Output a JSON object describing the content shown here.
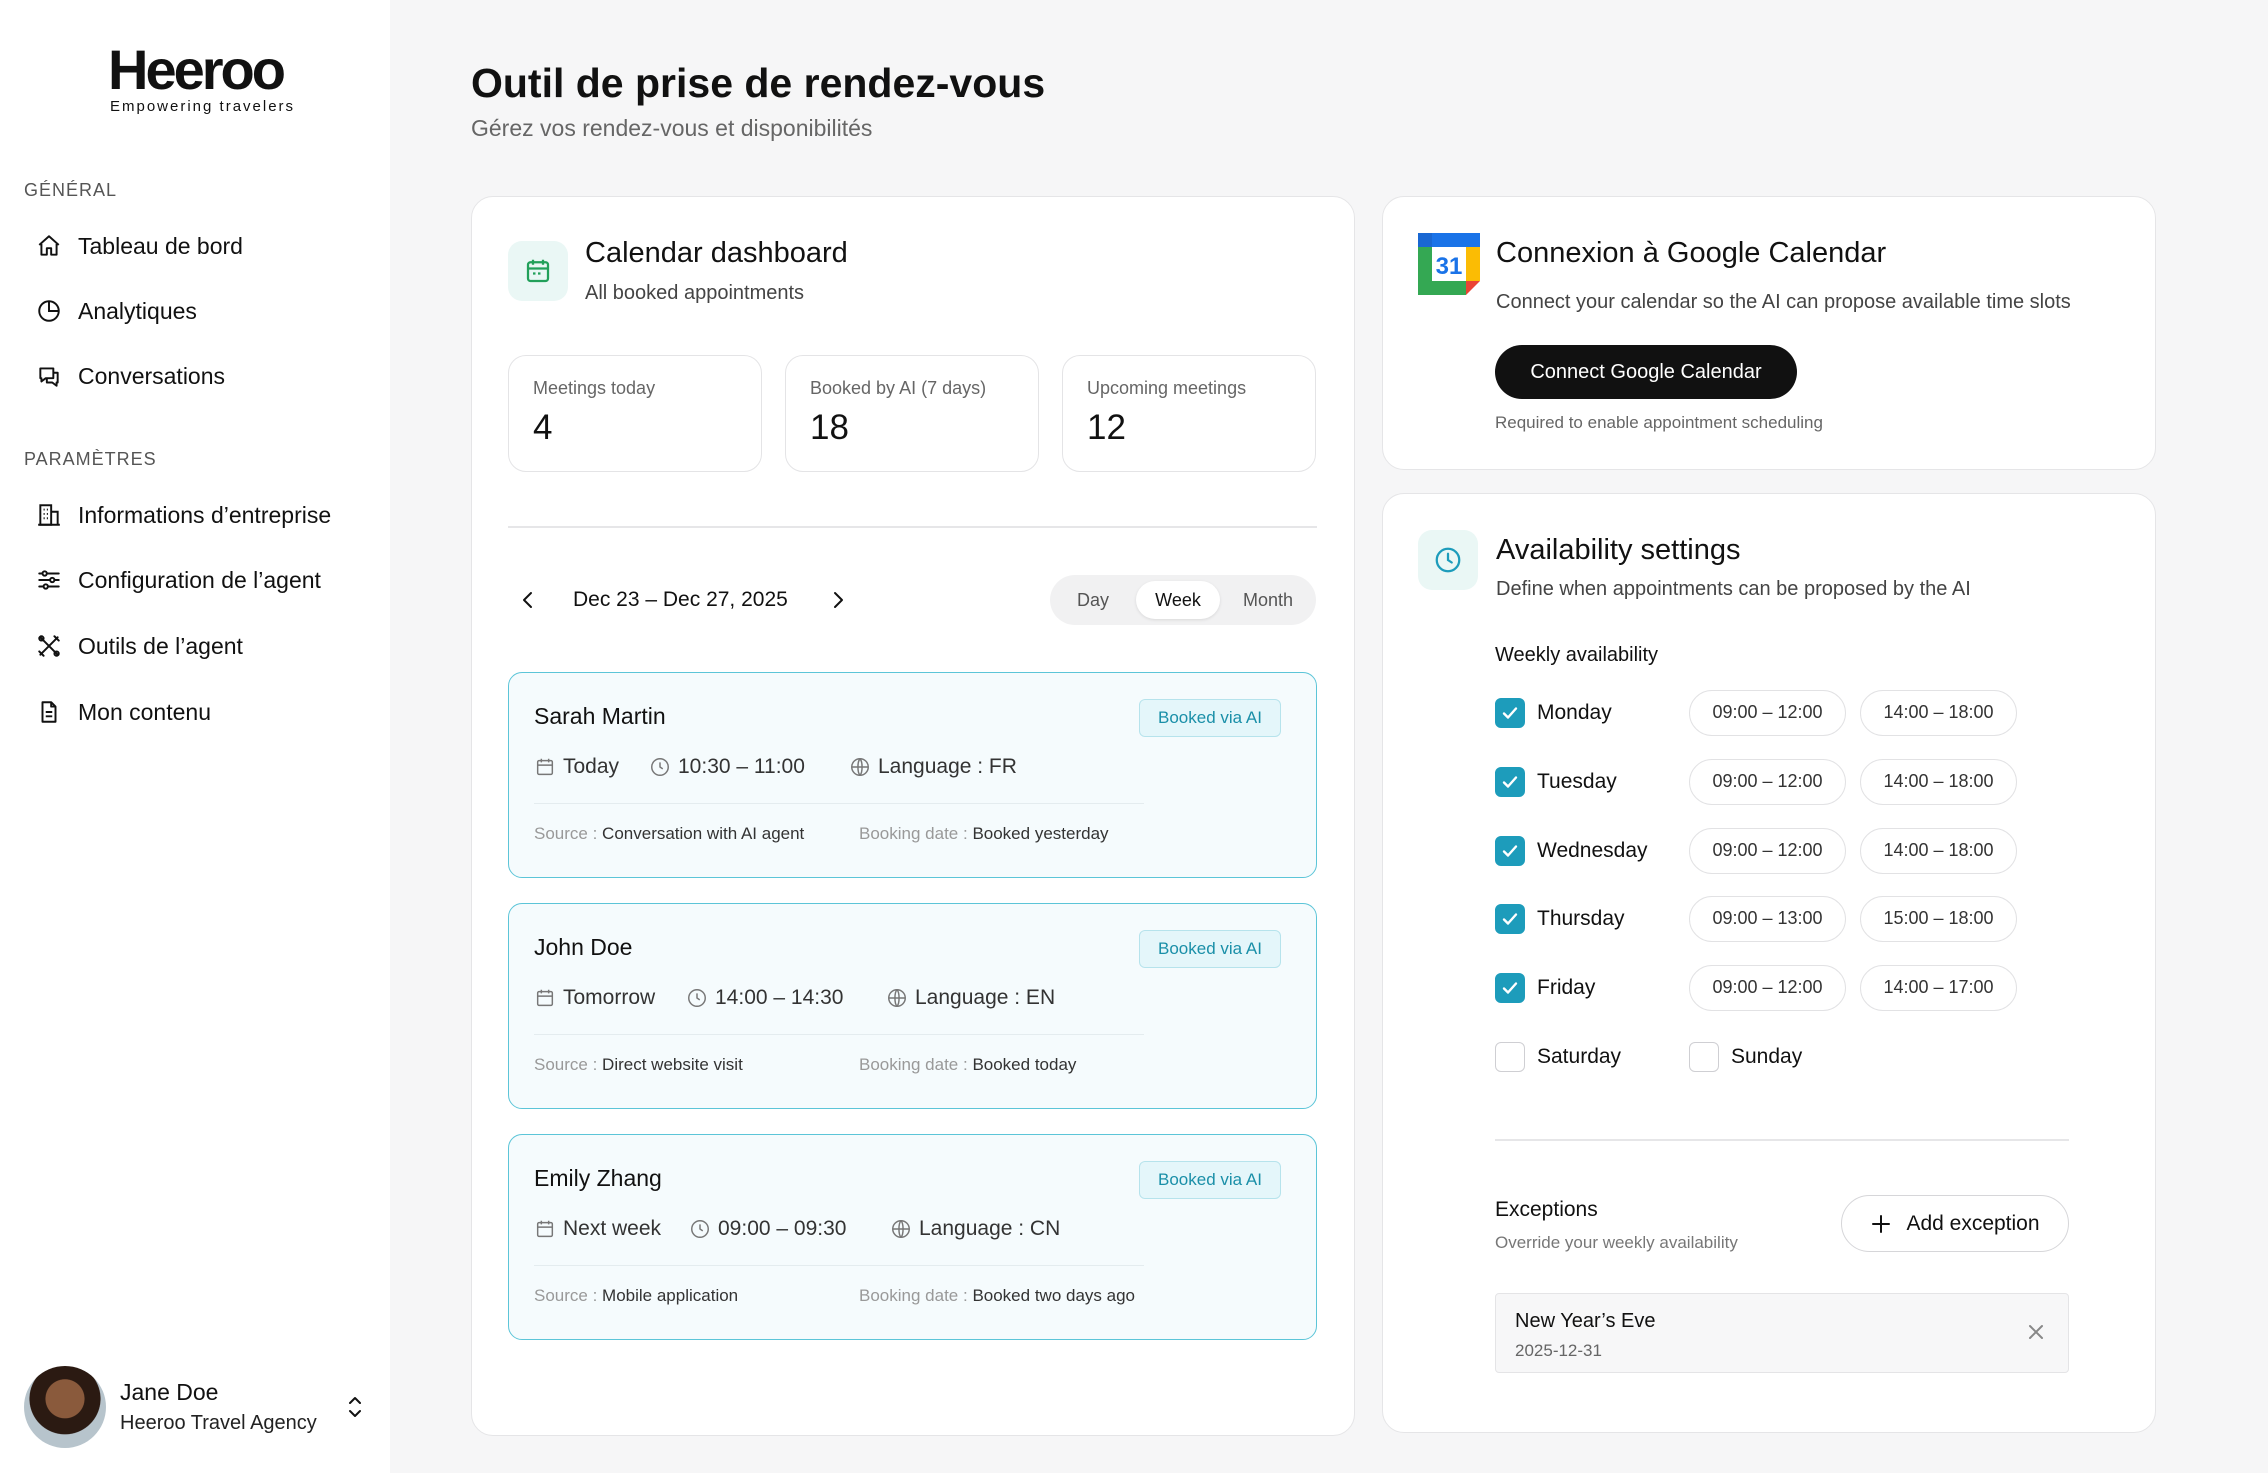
{
  "brand": {
    "name": "Heeroo",
    "tagline": "Empowering travelers"
  },
  "sidebar": {
    "section_general": "GÉNÉRAL",
    "general_items": [
      {
        "label": "Tableau de bord",
        "icon": "home-icon"
      },
      {
        "label": "Analytiques",
        "icon": "pie-chart-icon"
      },
      {
        "label": "Conversations",
        "icon": "chat-icon"
      }
    ],
    "section_settings": "PARAMÈTRES",
    "settings_items": [
      {
        "label": "Informations d’entreprise",
        "icon": "building-icon"
      },
      {
        "label": "Configuration de l’agent",
        "icon": "sliders-icon"
      },
      {
        "label": "Outils de l’agent",
        "icon": "tools-icon"
      },
      {
        "label": "Mon contenu",
        "icon": "document-icon"
      }
    ],
    "user": {
      "name": "Jane Doe",
      "org": "Heeroo Travel Agency"
    }
  },
  "page": {
    "title": "Outil de prise de rendez-vous",
    "subtitle": "Gérez vos rendez-vous et disponibilités"
  },
  "calendar": {
    "title": "Calendar dashboard",
    "subtitle": "All booked appointments",
    "stats": [
      {
        "label": "Meetings today",
        "value": "4"
      },
      {
        "label": "Booked by AI (7 days)",
        "value": "18"
      },
      {
        "label": "Upcoming meetings",
        "value": "12"
      }
    ],
    "range": "Dec 23 – Dec 27, 2025",
    "views": [
      "Day",
      "Week",
      "Month"
    ],
    "active_view": "Week",
    "source_label": "Source :",
    "booking_label": "Booking date :",
    "appointments": [
      {
        "name": "Sarah Martin",
        "badge": "Booked via AI",
        "day": "Today",
        "time": "10:30 – 11:00",
        "language": "Language : FR",
        "source": "Conversation with AI agent",
        "booking": "Booked yesterday"
      },
      {
        "name": "John Doe",
        "badge": "Booked via AI",
        "day": "Tomorrow",
        "time": "14:00 – 14:30",
        "language": "Language : EN",
        "source": "Direct website visit",
        "booking": "Booked today"
      },
      {
        "name": "Emily Zhang",
        "badge": "Booked via AI",
        "day": "Next week",
        "time": "09:00 – 09:30",
        "language": "Language : CN",
        "source": "Mobile application",
        "booking": "Booked two days ago"
      }
    ]
  },
  "google": {
    "title": "Connexion à Google Calendar",
    "subtitle": "Connect your calendar so the AI can propose available time slots",
    "button": "Connect Google Calendar",
    "note": "Required to enable appointment scheduling",
    "logo_day": "31"
  },
  "availability": {
    "title": "Availability settings",
    "subtitle": "Define when appointments can be proposed by the AI",
    "weekly_title": "Weekly availability",
    "days": [
      {
        "name": "Monday",
        "checked": true,
        "slots": [
          "09:00 – 12:00",
          "14:00 – 18:00"
        ]
      },
      {
        "name": "Tuesday",
        "checked": true,
        "slots": [
          "09:00 – 12:00",
          "14:00 – 18:00"
        ]
      },
      {
        "name": "Wednesday",
        "checked": true,
        "slots": [
          "09:00 – 12:00",
          "14:00 – 18:00"
        ]
      },
      {
        "name": "Thursday",
        "checked": true,
        "slots": [
          "09:00 – 13:00",
          "15:00 – 18:00"
        ]
      },
      {
        "name": "Friday",
        "checked": true,
        "slots": [
          "09:00 – 12:00",
          "14:00 – 17:00"
        ]
      }
    ],
    "weekend": [
      {
        "name": "Saturday",
        "checked": false
      },
      {
        "name": "Sunday",
        "checked": false
      }
    ],
    "exceptions_title": "Exceptions",
    "exceptions_subtitle": "Override your weekly availability",
    "add_exception": "Add exception",
    "exceptions": [
      {
        "name": "New Year’s Eve",
        "date": "2025-12-31"
      }
    ]
  },
  "colors": {
    "accent": "#1d9cbb",
    "primary_button": "#111111",
    "appointment_border": "#5cc5d8"
  }
}
